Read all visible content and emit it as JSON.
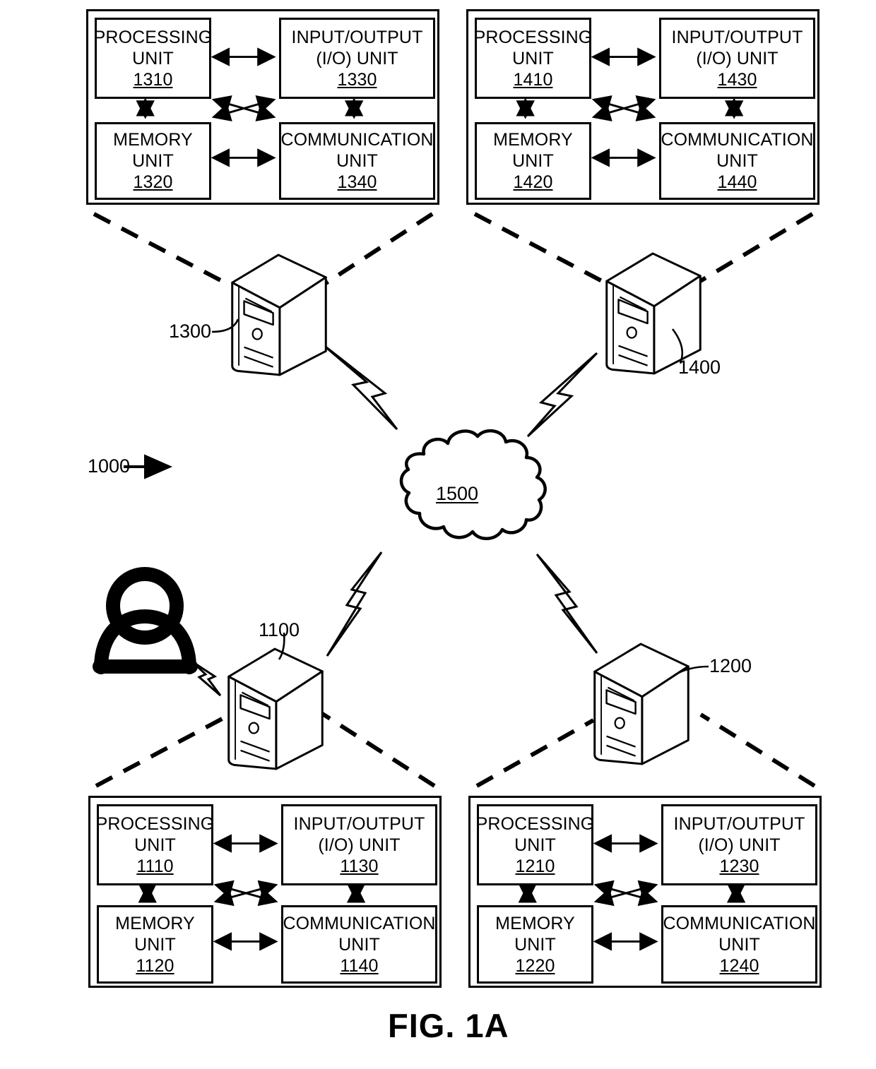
{
  "figure": {
    "caption": "FIG. 1A",
    "system_ref": "1000",
    "network_ref": "1500"
  },
  "nodes": [
    {
      "id": "device-1300",
      "ref": "1300",
      "icon": "server-tower-icon"
    },
    {
      "id": "device-1400",
      "ref": "1400",
      "icon": "server-tower-icon"
    },
    {
      "id": "device-1100",
      "ref": "1100",
      "icon": "server-tower-icon"
    },
    {
      "id": "device-1200",
      "ref": "1200",
      "icon": "server-tower-icon"
    },
    {
      "id": "user",
      "ref": "",
      "icon": "user-person-icon"
    }
  ],
  "panels": [
    {
      "id": "panel-1300",
      "position": "top-left",
      "units": [
        {
          "slot": "processing",
          "title": "PROCESSING\nUNIT",
          "ref": "1310"
        },
        {
          "slot": "io",
          "title": "INPUT/OUTPUT\n(I/O) UNIT",
          "ref": "1330"
        },
        {
          "slot": "memory",
          "title": "MEMORY\nUNIT",
          "ref": "1320"
        },
        {
          "slot": "communication",
          "title": "COMMUNICATION\nUNIT",
          "ref": "1340"
        }
      ]
    },
    {
      "id": "panel-1400",
      "position": "top-right",
      "units": [
        {
          "slot": "processing",
          "title": "PROCESSING\nUNIT",
          "ref": "1410"
        },
        {
          "slot": "io",
          "title": "INPUT/OUTPUT\n(I/O) UNIT",
          "ref": "1430"
        },
        {
          "slot": "memory",
          "title": "MEMORY\nUNIT",
          "ref": "1420"
        },
        {
          "slot": "communication",
          "title": "COMMUNICATION\nUNIT",
          "ref": "1440"
        }
      ]
    },
    {
      "id": "panel-1100",
      "position": "bottom-left",
      "units": [
        {
          "slot": "processing",
          "title": "PROCESSING\nUNIT",
          "ref": "1110"
        },
        {
          "slot": "io",
          "title": "INPUT/OUTPUT\n(I/O) UNIT",
          "ref": "1130"
        },
        {
          "slot": "memory",
          "title": "MEMORY\nUNIT",
          "ref": "1120"
        },
        {
          "slot": "communication",
          "title": "COMMUNICATION\nUNIT",
          "ref": "1140"
        }
      ]
    },
    {
      "id": "panel-1200",
      "position": "bottom-right",
      "units": [
        {
          "slot": "processing",
          "title": "PROCESSING\nUNIT",
          "ref": "1210"
        },
        {
          "slot": "io",
          "title": "INPUT/OUTPUT\n(I/O) UNIT",
          "ref": "1230"
        },
        {
          "slot": "memory",
          "title": "MEMORY\nUNIT",
          "ref": "1220"
        },
        {
          "slot": "communication",
          "title": "COMMUNICATION\nUNIT",
          "ref": "1240"
        }
      ]
    }
  ],
  "colors": {
    "line": "#000000",
    "background": "#ffffff"
  }
}
